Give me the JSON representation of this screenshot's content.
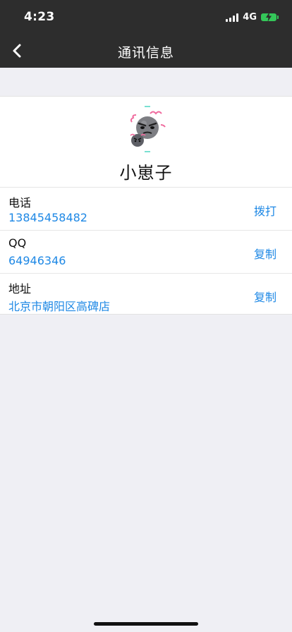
{
  "status_bar": {
    "time": "4:23",
    "network": "4G"
  },
  "nav": {
    "title": "通讯信息",
    "back_icon": "chevron-left-icon"
  },
  "contact": {
    "avatar_icon": "angry-face-avatar",
    "name": "小崽子"
  },
  "rows": [
    {
      "label": "电话",
      "value": "13845458482",
      "action": "拨打"
    },
    {
      "label": "QQ",
      "value": "64946346",
      "action": "复制"
    },
    {
      "label": "地址",
      "value": "北京市朝阳区高碑店",
      "action": "复制"
    }
  ],
  "colors": {
    "nav_background": "#2d2d2d",
    "page_background": "#efeff4",
    "accent_blue": "#1e88e5",
    "battery_green": "#34c759"
  }
}
